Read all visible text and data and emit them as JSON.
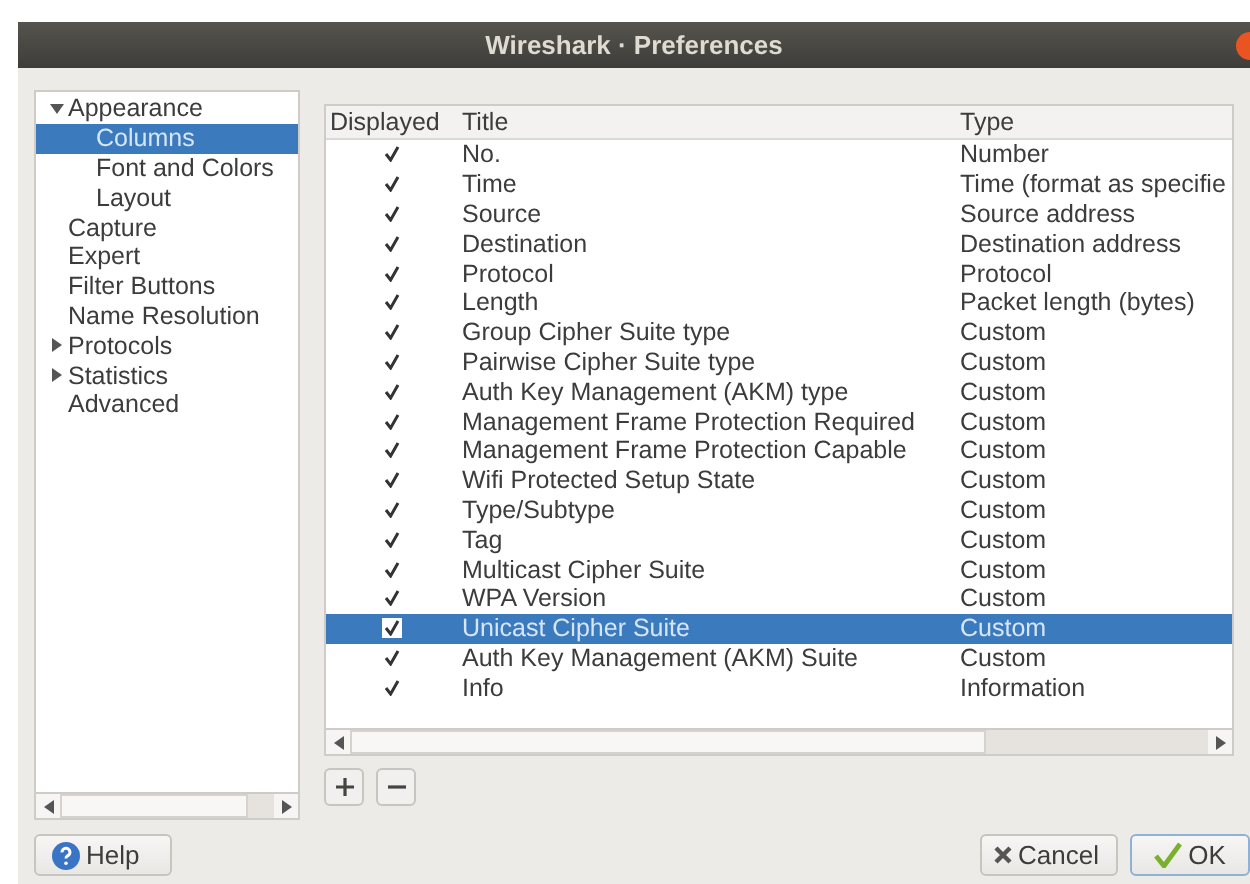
{
  "window": {
    "title": "Wireshark · Preferences"
  },
  "sidebar": {
    "items": [
      {
        "label": "Appearance",
        "expanded": true,
        "selected": false,
        "children": [
          {
            "label": "Columns",
            "selected": true
          },
          {
            "label": "Font and Colors",
            "selected": false
          },
          {
            "label": "Layout",
            "selected": false
          }
        ]
      },
      {
        "label": "Capture",
        "selected": false
      },
      {
        "label": "Expert",
        "selected": false
      },
      {
        "label": "Filter Buttons",
        "selected": false
      },
      {
        "label": "Name Resolution",
        "selected": false
      },
      {
        "label": "Protocols",
        "expanded": false,
        "selected": false
      },
      {
        "label": "Statistics",
        "expanded": false,
        "selected": false
      },
      {
        "label": "Advanced",
        "selected": false
      }
    ]
  },
  "table": {
    "columns": [
      "Displayed",
      "Title",
      "Type"
    ],
    "rows": [
      {
        "displayed": true,
        "title": "No.",
        "type": "Number",
        "selected": false
      },
      {
        "displayed": true,
        "title": "Time",
        "type": "Time (format as specifie",
        "selected": false
      },
      {
        "displayed": true,
        "title": "Source",
        "type": "Source address",
        "selected": false
      },
      {
        "displayed": true,
        "title": "Destination",
        "type": "Destination address",
        "selected": false
      },
      {
        "displayed": true,
        "title": "Protocol",
        "type": "Protocol",
        "selected": false
      },
      {
        "displayed": true,
        "title": "Length",
        "type": "Packet length (bytes)",
        "selected": false
      },
      {
        "displayed": true,
        "title": "Group Cipher Suite type",
        "type": "Custom",
        "selected": false
      },
      {
        "displayed": true,
        "title": "Pairwise Cipher Suite type",
        "type": "Custom",
        "selected": false
      },
      {
        "displayed": true,
        "title": "Auth Key Management (AKM) type",
        "type": "Custom",
        "selected": false
      },
      {
        "displayed": true,
        "title": "Management Frame Protection Required",
        "type": "Custom",
        "selected": false
      },
      {
        "displayed": true,
        "title": "Management Frame Protection Capable",
        "type": "Custom",
        "selected": false
      },
      {
        "displayed": true,
        "title": "Wifi Protected Setup State",
        "type": "Custom",
        "selected": false
      },
      {
        "displayed": true,
        "title": "Type/Subtype",
        "type": "Custom",
        "selected": false
      },
      {
        "displayed": true,
        "title": "Tag",
        "type": "Custom",
        "selected": false
      },
      {
        "displayed": true,
        "title": "Multicast Cipher Suite",
        "type": "Custom",
        "selected": false
      },
      {
        "displayed": true,
        "title": "WPA Version",
        "type": "Custom",
        "selected": false
      },
      {
        "displayed": true,
        "title": "Unicast Cipher Suite",
        "type": "Custom",
        "selected": true
      },
      {
        "displayed": true,
        "title": "Auth Key Management (AKM) Suite",
        "type": "Custom",
        "selected": false
      },
      {
        "displayed": true,
        "title": "Info",
        "type": "Information",
        "selected": false
      }
    ]
  },
  "buttons": {
    "help": "Help",
    "cancel": "Cancel",
    "ok": "OK"
  }
}
